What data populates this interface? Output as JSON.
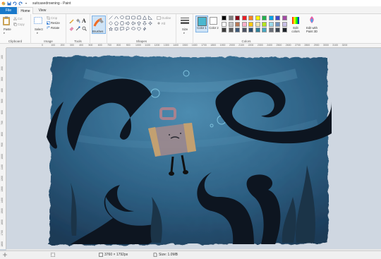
{
  "window": {
    "title": "suitcasedrowning - Paint"
  },
  "quick_access": [
    "save-icon",
    "undo-icon",
    "redo-icon",
    "customize-chevron-icon"
  ],
  "tabs": {
    "file": "File",
    "home": "Home",
    "view": "View"
  },
  "ribbon": {
    "clipboard": {
      "paste": "Paste",
      "cut": "Cut",
      "copy": "Copy",
      "group": "Clipboard"
    },
    "image": {
      "select": "Select",
      "crop": "Crop",
      "resize": "Resize",
      "rotate": "Rotate",
      "group": "Image"
    },
    "tools": {
      "group": "Tools"
    },
    "brushes": {
      "label": "Brushes"
    },
    "shapes": {
      "outline": "Outline",
      "fill": "Fill",
      "group": "Shapes"
    },
    "size": {
      "label": "Size"
    },
    "colors": {
      "color1": "Color 1",
      "color2": "Color 2",
      "edit": "Edit colors",
      "edit_paint3d": "Edit with Paint 3D",
      "group": "Colors",
      "color1_value": "#4bb7cf",
      "color2_value": "#ffffff",
      "palette_row1": [
        "#000000",
        "#7f7f7f",
        "#880015",
        "#ed1c24",
        "#ff7f27",
        "#fff200",
        "#22b14c",
        "#00a2e8",
        "#3f48cc",
        "#a349a4"
      ],
      "palette_row2": [
        "#ffffff",
        "#c3c3c3",
        "#b97a57",
        "#ffaec9",
        "#ffc90e",
        "#efe4b0",
        "#b5e61d",
        "#99d9ea",
        "#7092be",
        "#c8bfe7"
      ],
      "palette_row3": [
        "#3b3b3b",
        "#5a5a5a",
        "#3e5a78",
        "#4a5060",
        "#2e4f6e",
        "#2f7f98",
        "#46a7c0",
        "#6a6f78",
        "#3c4652",
        "#1d2229"
      ]
    }
  },
  "ruler": {
    "top_ticks": [
      "0",
      "100",
      "200",
      "300",
      "400",
      "500",
      "600",
      "700",
      "800",
      "900",
      "1000",
      "1100",
      "1200",
      "1300",
      "1400",
      "1500",
      "1600",
      "1700",
      "1800",
      "1900",
      "2000",
      "2100",
      "2200",
      "2300",
      "2400",
      "2500",
      "2600",
      "2700",
      "2800",
      "2900",
      "3000",
      "3100",
      "3200"
    ],
    "left_ticks": [
      "100",
      "200",
      "300",
      "400",
      "500",
      "600",
      "700",
      "800",
      "900",
      "1000",
      "1100",
      "1200",
      "1300",
      "1400",
      "1500",
      "1600",
      "1700",
      "1800"
    ]
  },
  "status": {
    "dimensions": "3760 × 1792px",
    "size": "Size: 1.0MB"
  }
}
